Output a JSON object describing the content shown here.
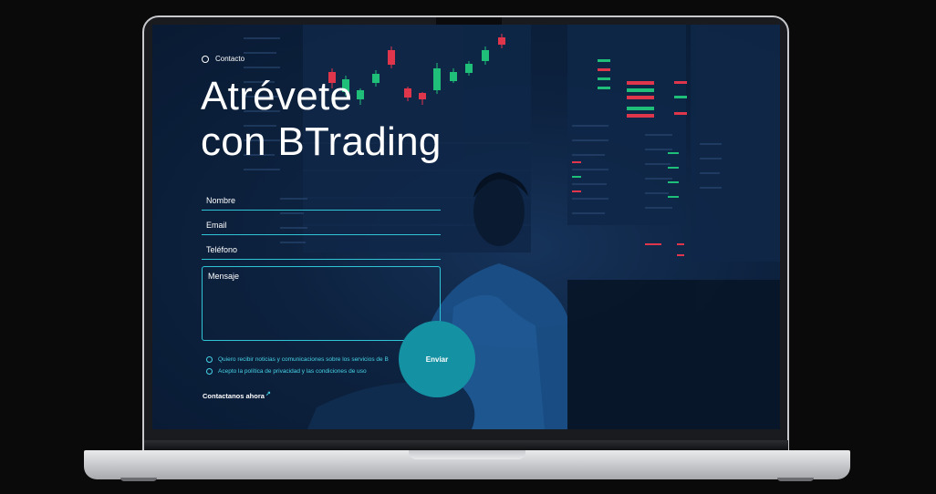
{
  "breadcrumb": {
    "label": "Contacto"
  },
  "headline": {
    "line1": "Atrévete",
    "line2": "con BTrading"
  },
  "form": {
    "name_label": "Nombre",
    "email_label": "Email",
    "phone_label": "Teléfono",
    "message_label": "Mensaje",
    "submit_label": "Enviar",
    "consent_news": "Quiero recibir noticias y comunicaciones sobre los servicios de B",
    "consent_privacy": "Acepto la política de privacidad y las condiciones de uso"
  },
  "cta": {
    "label": "Contactanos ahora",
    "arrow": "↗"
  },
  "colors": {
    "accent": "#2fc4d6",
    "button": "#1492a4",
    "screen_bg": "#0d223f",
    "candle_up": "#1fbf7a",
    "candle_down": "#e0364c"
  },
  "icons": [
    "radio-ring-icon",
    "arrow-up-right-icon",
    "laptop-camera-icon"
  ]
}
